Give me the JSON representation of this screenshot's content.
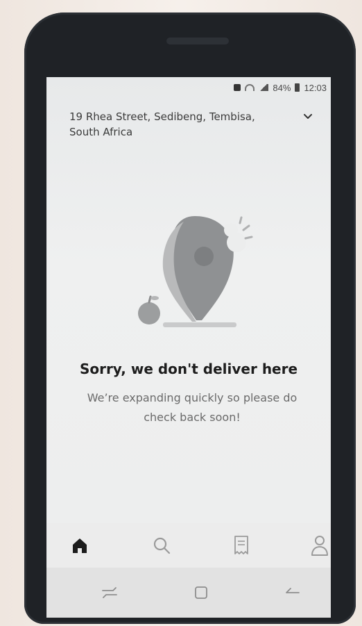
{
  "status_bar": {
    "battery": "84%",
    "time": "12:03"
  },
  "header": {
    "address": "19 Rhea Street, Sedibeng, Tembisa, South Africa",
    "dropdown_icon": "chevron-down-icon"
  },
  "empty_state": {
    "illustration": "map-pin-bitten-icon",
    "title": "Sorry, we don't deliver here",
    "message": "We’re expanding quickly so please do check back soon!"
  },
  "bottom_nav": {
    "items": [
      {
        "name": "home",
        "icon": "home-icon",
        "active": true
      },
      {
        "name": "search",
        "icon": "search-icon",
        "active": false
      },
      {
        "name": "orders",
        "icon": "receipt-icon",
        "active": false
      },
      {
        "name": "profile",
        "icon": "user-icon",
        "active": false
      }
    ]
  },
  "colors": {
    "active_nav": "#1c1c1c",
    "inactive_nav": "#9a9a9a",
    "title_text": "#1d1d1d",
    "body_text": "#6a6a6a",
    "illustration_gray": "#9c9c9c"
  }
}
